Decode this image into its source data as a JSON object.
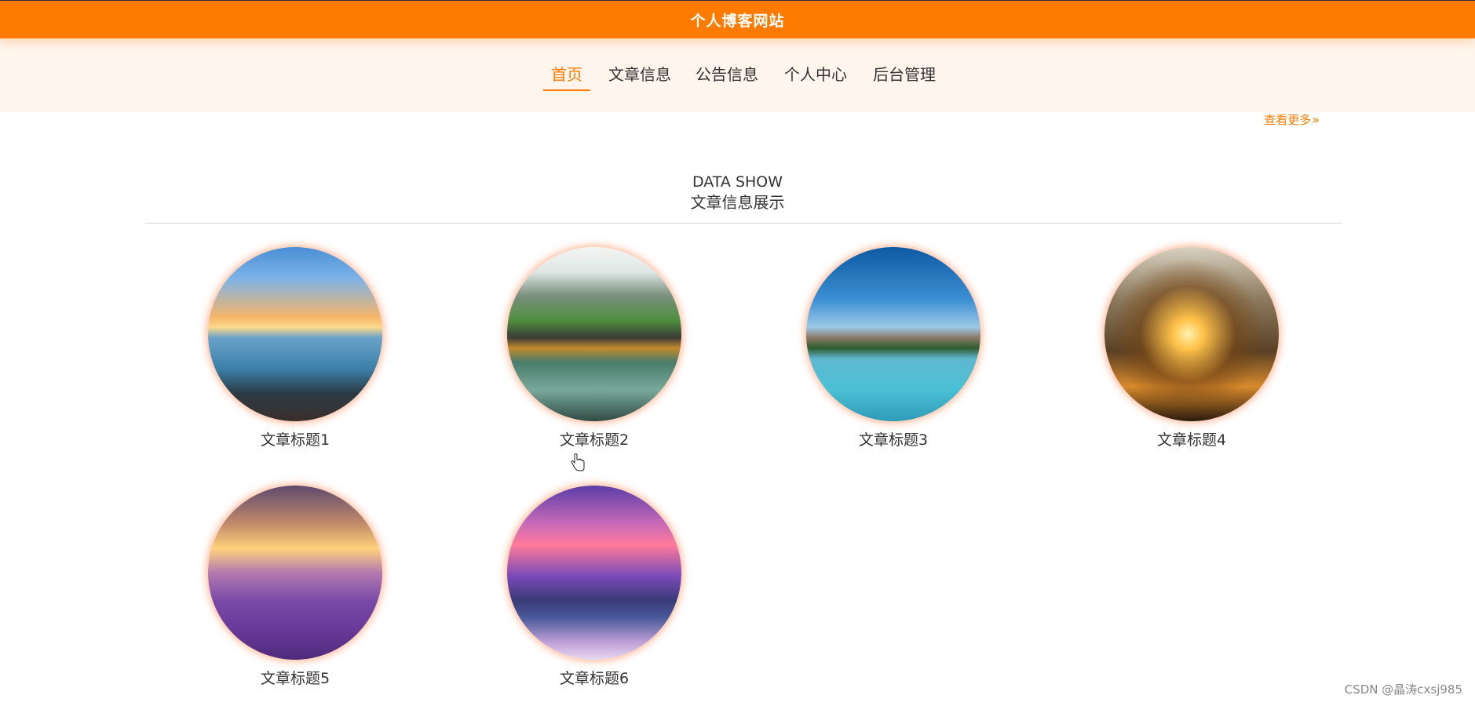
{
  "header": {
    "site_title": "个人博客网站"
  },
  "nav": {
    "items": [
      {
        "label": "首页",
        "active": true
      },
      {
        "label": "文章信息",
        "active": false
      },
      {
        "label": "公告信息",
        "active": false
      },
      {
        "label": "个人中心",
        "active": false
      },
      {
        "label": "后台管理",
        "active": false
      }
    ]
  },
  "more_link": {
    "label": "查看更多",
    "icon": "double-chevron-right-icon"
  },
  "section": {
    "title_en": "DATA SHOW",
    "title_cn": "文章信息展示"
  },
  "articles": [
    {
      "title": "文章标题1",
      "image": "sunset-pier-seascape"
    },
    {
      "title": "文章标题2",
      "image": "stone-bridge-mountains-lake"
    },
    {
      "title": "文章标题3",
      "image": "mountain-lake-reflection"
    },
    {
      "title": "文章标题4",
      "image": "tree-sunset-glow"
    },
    {
      "title": "文章标题5",
      "image": "lavender-field-sunset"
    },
    {
      "title": "文章标题6",
      "image": "purple-sky-crater-lake"
    }
  ],
  "watermark": "CSDN @晶涛cxsj985",
  "colors": {
    "accent": "#ff7b00",
    "nav_band": "#fff5ec"
  }
}
